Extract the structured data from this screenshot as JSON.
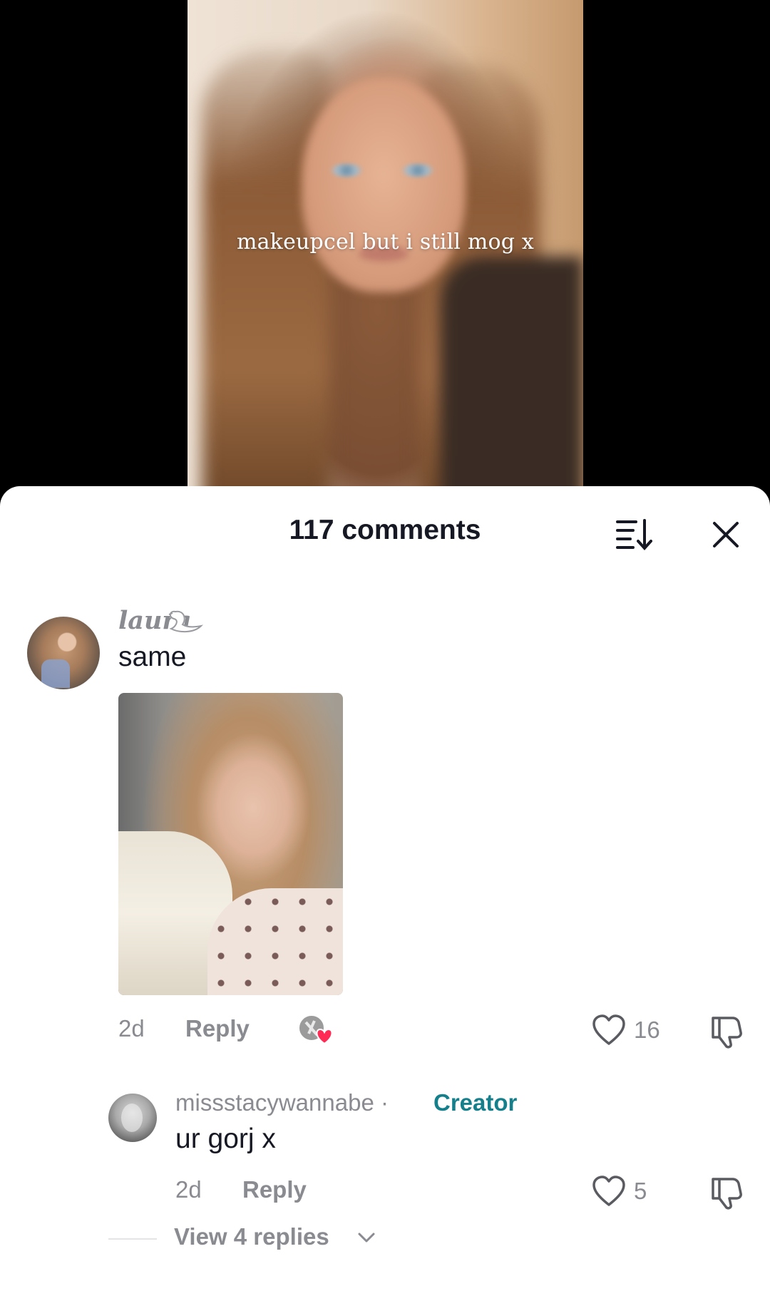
{
  "video": {
    "caption": "makeupcel but i still mog x"
  },
  "sheet": {
    "title": "117 comments",
    "icons": {
      "sort": "sort-icon",
      "close": "close-icon"
    }
  },
  "comments": [
    {
      "username": "laura",
      "username_icon": "swan-icon",
      "text": "same",
      "has_image": true,
      "time": "2d",
      "reply_label": "Reply",
      "creator_liked": true,
      "likes": "16"
    },
    {
      "username": "missstacywannabe",
      "separator": "·",
      "badge": "Creator",
      "text": "ur gorj x",
      "time": "2d",
      "reply_label": "Reply",
      "likes": "5"
    }
  ],
  "view_replies": "View 4 replies",
  "colors": {
    "text_primary": "#161823",
    "text_secondary": "#8a8b91",
    "creator_badge": "#15808c",
    "heart_accent": "#fe2c55"
  }
}
